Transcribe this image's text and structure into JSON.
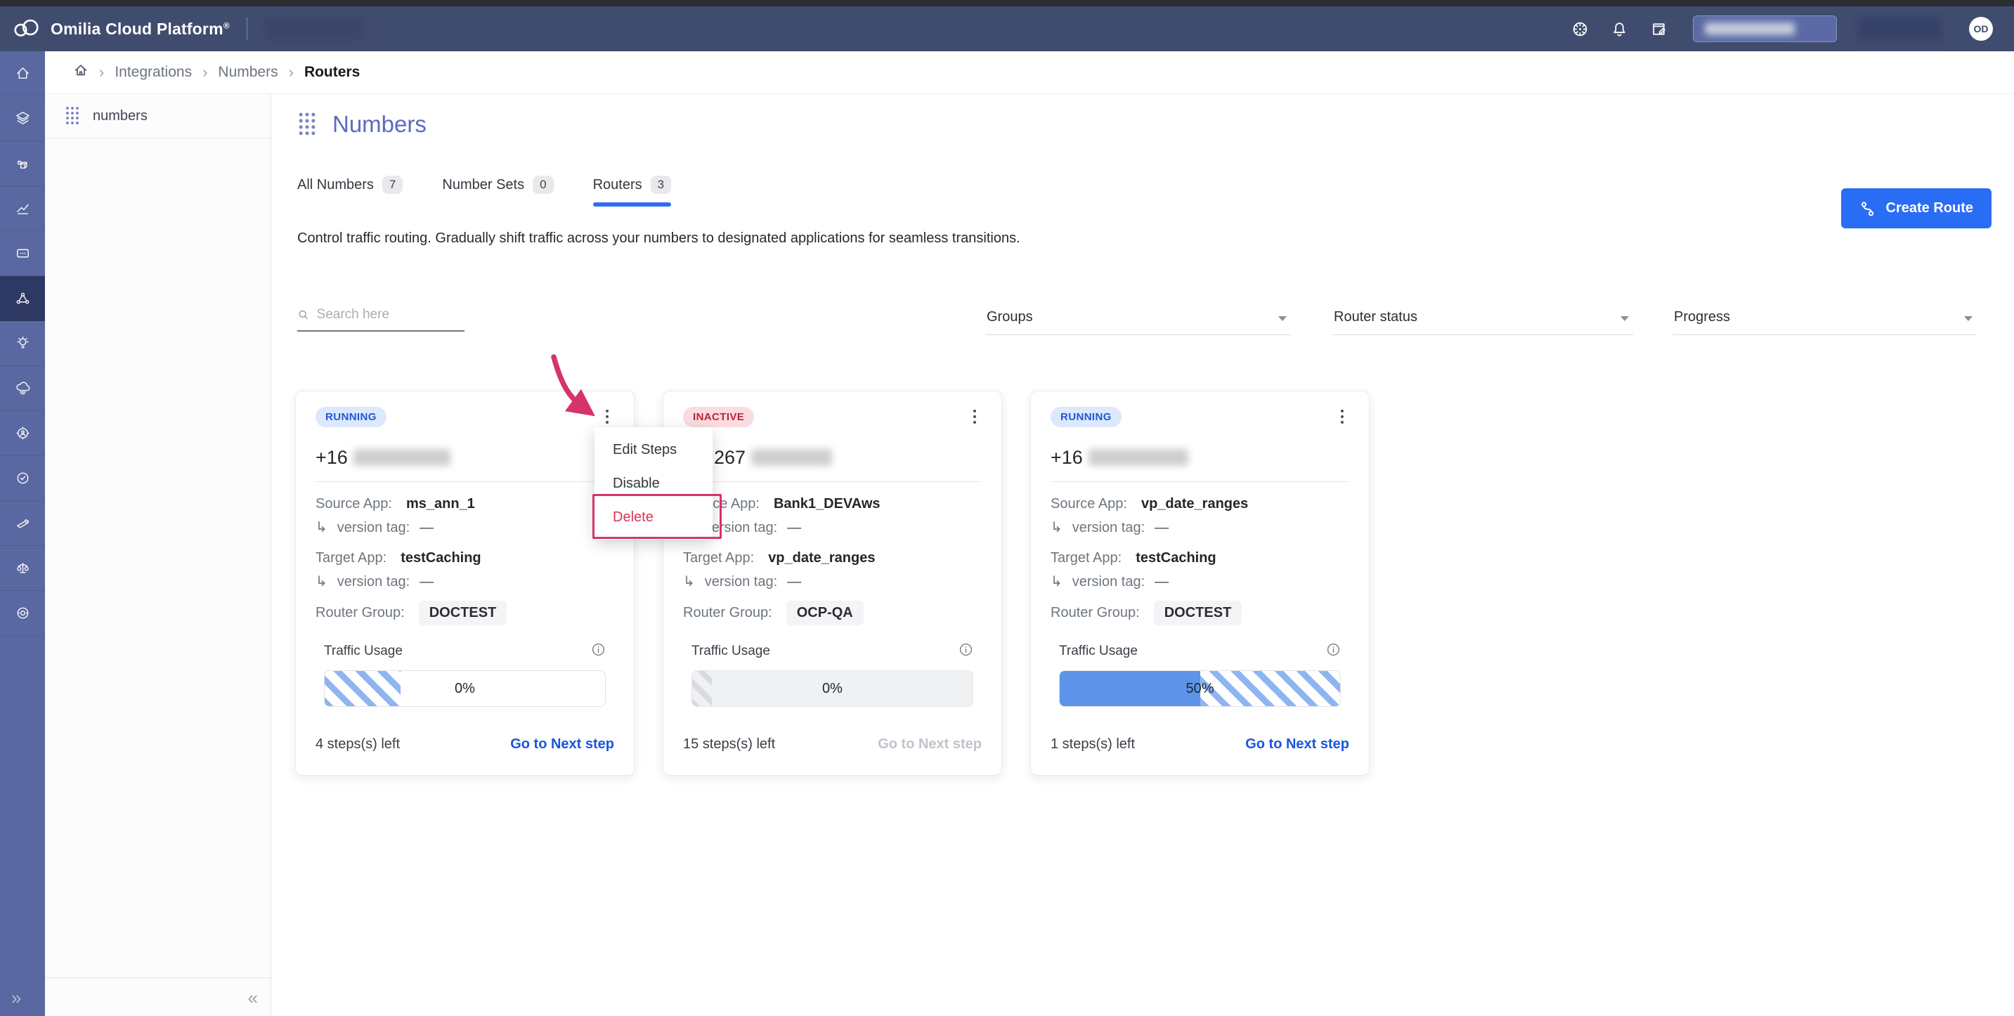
{
  "topbar": {
    "brand": "Omilia Cloud Platform",
    "trademark": "®",
    "avatar": "OD"
  },
  "breadcrumb": {
    "separator": "›",
    "items": [
      "Integrations",
      "Numbers",
      "Routers"
    ]
  },
  "rail": {
    "expand_glyph": "»",
    "items": [
      "home",
      "layers",
      "blocks",
      "analytics",
      "chat",
      "network",
      "insights",
      "cloud",
      "gear-user",
      "badge-check",
      "tools",
      "scale",
      "records"
    ],
    "active_item": "network"
  },
  "panel": {
    "item_label": "numbers",
    "collapse_glyph": "«"
  },
  "page": {
    "title": "Numbers",
    "tabs": [
      {
        "label": "All Numbers",
        "count": "7"
      },
      {
        "label": "Number Sets",
        "count": "0"
      },
      {
        "label": "Routers",
        "count": "3"
      }
    ],
    "active_tab": "Routers",
    "description": "Control traffic routing. Gradually shift traffic across your numbers to designated applications for seamless transitions.",
    "create_button": "Create Route"
  },
  "filters": {
    "search_placeholder": "Search here",
    "groups_label": "Groups",
    "router_status_label": "Router status",
    "progress_label": "Progress"
  },
  "labels": {
    "source_app": "Source App:",
    "target_app": "Target App:",
    "version_tag": "version tag:",
    "version_arrow": "↳",
    "router_group": "Router Group:",
    "traffic_usage": "Traffic Usage",
    "go_to_next_step": "Go to Next step"
  },
  "cards": [
    {
      "status": "RUNNING",
      "status_type": "running",
      "phone_visible": "+16",
      "phone_shifted": false,
      "source_app": "ms_ann_1",
      "source_version": "—",
      "target_app": "testCaching",
      "target_version": "—",
      "router_group": "DOCTEST",
      "progress_label": "0%",
      "bar": {
        "fill_pct": 0,
        "stripe_left_pct": 0,
        "stripe_width_pct": 27,
        "stripe_style": "blue",
        "track": "white"
      },
      "steps_left": "4 steps(s) left",
      "next_step_enabled": true
    },
    {
      "status": "INACTIVE",
      "status_type": "inactive",
      "phone_visible": "267",
      "phone_shifted": true,
      "source_app": "Bank1_DEVAws",
      "source_version": "—",
      "target_app": "vp_date_ranges",
      "target_version": "—",
      "router_group": "OCP-QA",
      "progress_label": "0%",
      "bar": {
        "fill_pct": 0,
        "stripe_left_pct": 0,
        "stripe_width_pct": 7,
        "stripe_style": "gray",
        "track": "gray"
      },
      "steps_left": "15 steps(s) left",
      "next_step_enabled": false
    },
    {
      "status": "RUNNING",
      "status_type": "running",
      "phone_visible": "+16",
      "phone_shifted": false,
      "source_app": "vp_date_ranges",
      "source_version": "—",
      "target_app": "testCaching",
      "target_version": "—",
      "router_group": "DOCTEST",
      "progress_label": "50%",
      "bar": {
        "fill_pct": 50,
        "stripe_left_pct": 50,
        "stripe_width_pct": 50,
        "stripe_style": "blue",
        "track": "white"
      },
      "steps_left": "1 steps(s) left",
      "next_step_enabled": true
    }
  ],
  "context_menu": {
    "items": [
      {
        "label": "Edit Steps",
        "danger": false
      },
      {
        "label": "Disable",
        "danger": false
      },
      {
        "label": "Delete",
        "danger": true
      }
    ]
  },
  "colors": {
    "topbar": "#404c6e",
    "rail": "#5a68a1",
    "rail_active": "#2e3963",
    "title_indigo": "#5c6bc0",
    "accent_blue": "#2a6df5",
    "link_blue": "#1a56db",
    "running_text": "#2058d8",
    "running_bg": "#dce8fc",
    "inactive_text": "#bb2532",
    "inactive_bg": "#fadbe1",
    "annotation_pink": "#d6336c"
  }
}
